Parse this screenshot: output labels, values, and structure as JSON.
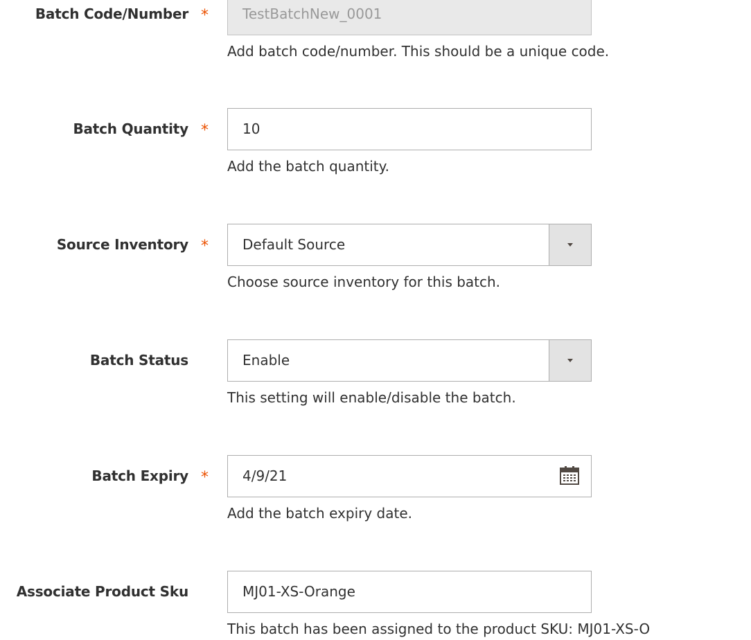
{
  "form": {
    "batch_code": {
      "label": "Batch Code/Number",
      "required_mark": "*",
      "value": "TestBatchNew_0001",
      "note": "Add batch code/number. This should be a unique code."
    },
    "batch_quantity": {
      "label": "Batch Quantity",
      "required_mark": "*",
      "value": "10",
      "note": "Add the batch quantity."
    },
    "source_inventory": {
      "label": "Source Inventory",
      "required_mark": "*",
      "value": "Default Source",
      "note": "Choose source inventory for this batch."
    },
    "batch_status": {
      "label": "Batch Status",
      "value": "Enable",
      "note": "This setting will enable/disable the batch."
    },
    "batch_expiry": {
      "label": "Batch Expiry",
      "required_mark": "*",
      "value": "4/9/21",
      "note": "Add the batch expiry date."
    },
    "associate_sku": {
      "label": "Associate Product Sku",
      "value": "MJ01-XS-Orange",
      "note": "This batch has been assigned to the product SKU: MJ01-XS-O"
    }
  },
  "icons": {
    "select_arrow": "chevron-down-icon",
    "date_picker": "calendar-icon"
  },
  "colors": {
    "required": "#eb5202",
    "text": "#303030",
    "border": "#adadad",
    "disabled_bg": "#e9e9e9",
    "select_button_bg": "#e3e3e3"
  }
}
